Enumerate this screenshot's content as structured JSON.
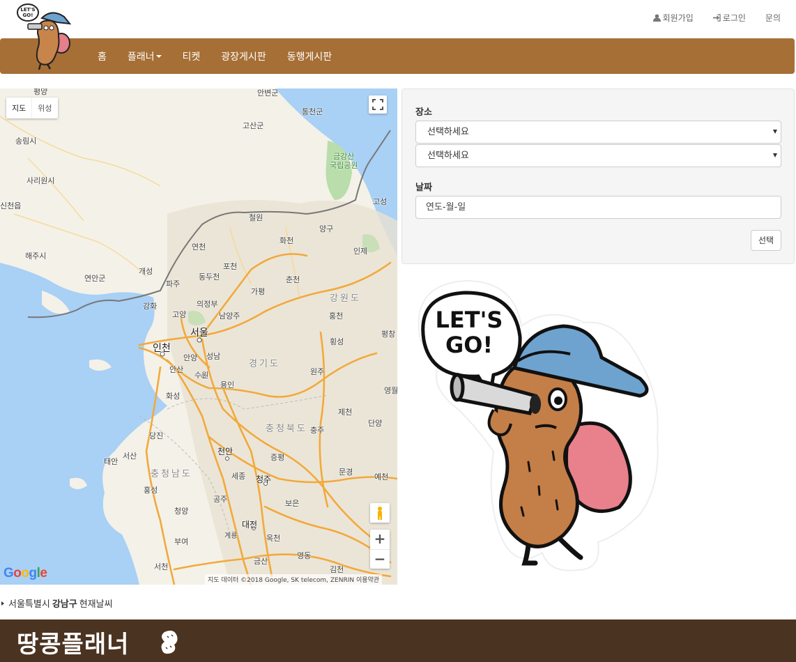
{
  "top_links": {
    "signup": "회원가입",
    "login": "로그인",
    "inquiry": "문의"
  },
  "logo_text": "LET'S GO!",
  "nav": {
    "items": [
      "홈",
      "플래너",
      "티켓",
      "광장게시판",
      "동행게시판"
    ]
  },
  "map": {
    "type_map": "지도",
    "type_satellite": "위성",
    "attribution": "지도 데이터 ©2018 Google, SK telecom, ZENRIN   이용약관",
    "google": "Google",
    "labels": {
      "pyongyang": "평양",
      "anbyeon": "안변군",
      "tongcheon": "통천군",
      "goseong_n": "고산군",
      "songrim": "송림시",
      "sariwon": "사리원시",
      "sincheon": "신천읍",
      "haeju": "해주시",
      "yeonan": "연안군",
      "kaesong": "개성",
      "paju": "파주",
      "ganghwa": "강화",
      "goyang": "고양",
      "seoul": "서울",
      "incheon": "인천",
      "anyang": "안양",
      "seongnam": "성남",
      "ansan": "안산",
      "suwon": "수원",
      "yongin": "용인",
      "hwaseong": "화성",
      "uijeongbu": "의정부",
      "namyangju": "남양주",
      "dongducheon": "동두천",
      "pocheon": "포천",
      "gapyeong": "가평",
      "chuncheon": "춘천",
      "hwacheon": "화천",
      "cheorwon": "철원",
      "yeoncheon": "연천",
      "yanggu": "양구",
      "inje": "인제",
      "goseong_s": "고성",
      "hongcheon": "홍천",
      "hoengseong": "횡성",
      "wonju": "원주",
      "pyeongchang": "평창",
      "yeongwol": "영월",
      "jecheon": "제천",
      "danyang": "단양",
      "chungju": "충주",
      "cheonan": "천안",
      "jeungpyeong": "증평",
      "cheongju": "청주",
      "dangjin": "당진",
      "seosan": "서산",
      "taean": "태안",
      "hongseong": "홍성",
      "cheongyang": "청양",
      "buyeo": "부여",
      "gongju": "공주",
      "sejong": "세종",
      "daejeon": "대전",
      "gyeryong": "계룡",
      "boeun": "보은",
      "mungyeong": "문경",
      "yecheon": "예천",
      "okcheon": "옥천",
      "yeongdong": "영동",
      "geumsan": "금산",
      "gimcheon": "김천",
      "seocheon": "서천",
      "park": "금강산\n국립공원",
      "gyeonggi": "경기도",
      "gangwon": "강원도",
      "chungbuk": "충청북도",
      "chungnam": "충청남도"
    }
  },
  "form": {
    "place_label": "장소",
    "select1_value": "선택하세요",
    "select2_value": "선택하세요",
    "date_label": "날짜",
    "date_placeholder": "연도-월-일",
    "submit_label": "선택"
  },
  "mascot": {
    "speech_line1": "LET'S",
    "speech_line2": "GO!"
  },
  "weather": {
    "city": "서울특별시",
    "district": "강남구",
    "suffix": "현재날씨"
  },
  "footer": {
    "brand": "땅콩플래너"
  },
  "colors": {
    "nav_bg": "#a66f36",
    "footer_bg": "#4a3320",
    "panel_bg": "#f5f5f5",
    "sea": "#a9d0f5",
    "highway": "#f2a93b"
  }
}
